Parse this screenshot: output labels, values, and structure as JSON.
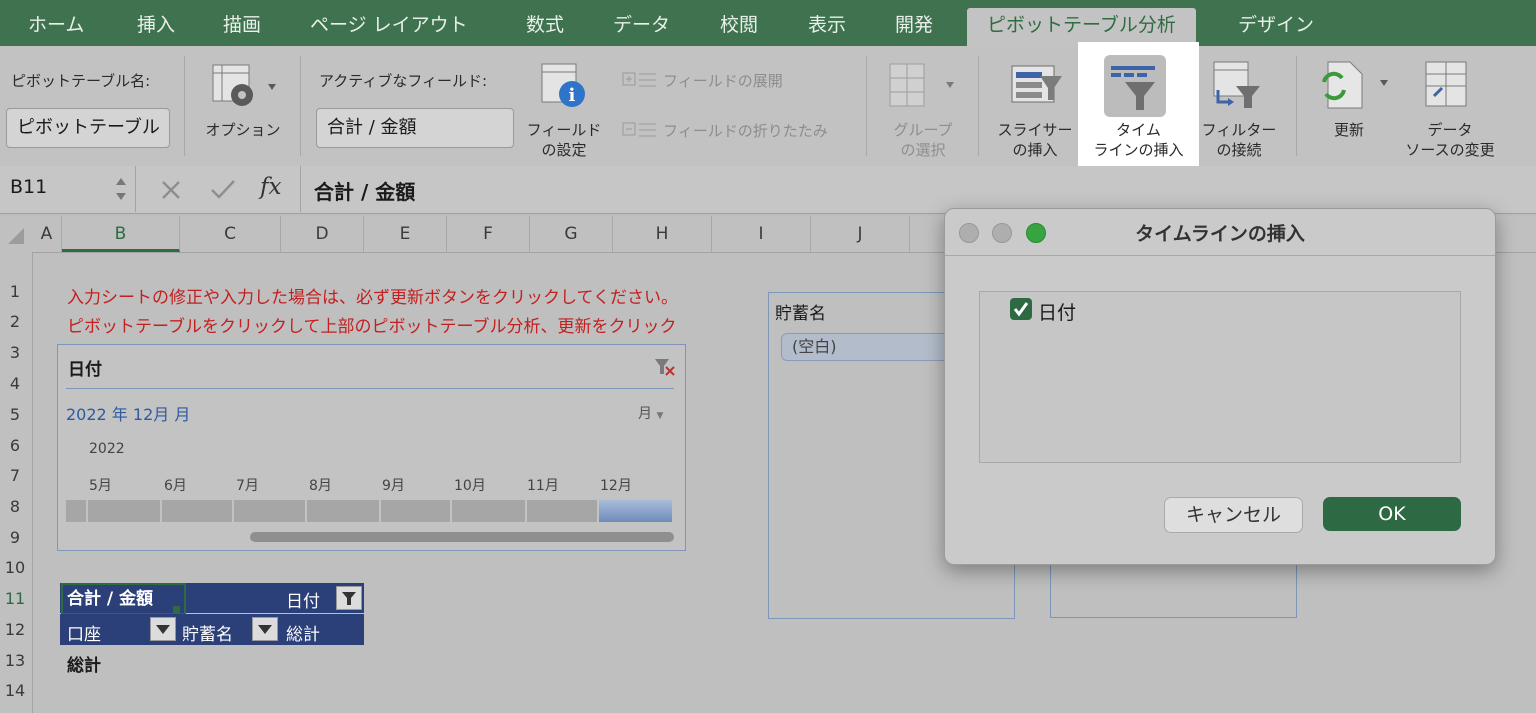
{
  "tabs": [
    "ホーム",
    "挿入",
    "描画",
    "ページ レイアウト",
    "数式",
    "データ",
    "校閲",
    "表示",
    "開発",
    "ピボットテーブル分析",
    "デザイン"
  ],
  "ribbon": {
    "pivot_name_label": "ピボットテーブル名:",
    "pivot_name_value": "ピボットテーブル",
    "options_label": "オプション",
    "active_field_label": "アクティブなフィールド:",
    "active_field_value": "合計 / 金額",
    "field_settings_l1": "フィールド",
    "field_settings_l2": "の設定",
    "expand_field": "フィールドの展開",
    "collapse_field": "フィールドの折りたたみ",
    "group_l1": "グループ",
    "group_l2": "の選択",
    "slicer_l1": "スライサー",
    "slicer_l2": "の挿入",
    "timeline_l1": "タイム",
    "timeline_l2": "ラインの挿入",
    "filter_l1": "フィルター",
    "filter_l2": "の接続",
    "refresh": "更新",
    "datasource_l1": "データ",
    "datasource_l2": "ソースの変更"
  },
  "formula_bar": {
    "cell_ref": "B11",
    "fx": "fx",
    "content": "合計 / 金額"
  },
  "columns": [
    "A",
    "B",
    "C",
    "D",
    "E",
    "F",
    "G",
    "H",
    "I",
    "J"
  ],
  "rows": [
    "1",
    "2",
    "3",
    "4",
    "5",
    "6",
    "7",
    "8",
    "9",
    "10",
    "11",
    "12",
    "13",
    "14"
  ],
  "notes": {
    "line1": "入力シートの修正や入力した場合は、必ず更新ボタンをクリックしてください。",
    "line2": "ピボットテーブルをクリックして上部のピボットテーブル分析、更新をクリック"
  },
  "timeline": {
    "title": "日付",
    "range_label": "2022 年 12月 月",
    "period": "月",
    "year": "2022",
    "months": [
      "5月",
      "6月",
      "7月",
      "8月",
      "9月",
      "10月",
      "11月",
      "12月"
    ],
    "selected_month": "12月"
  },
  "slicer": {
    "title": "貯蓄名",
    "item": "(空白)"
  },
  "pivot": {
    "header_value": "合計 / 金額",
    "col_field": "日付",
    "row_field1": "口座",
    "row_field2": "貯蓄名",
    "total_col": "総計",
    "grand_total": "総計"
  },
  "dialog": {
    "title": "タイムラインの挿入",
    "field": "日付",
    "field_checked": true,
    "cancel": "キャンセル",
    "ok": "OK"
  },
  "colors": {
    "tab_bar": "#3f7350",
    "accent_green": "#2e6b41",
    "pivot_header": "#2b3f78",
    "note_red": "#c32020",
    "ok_button": "#2d6a43"
  }
}
